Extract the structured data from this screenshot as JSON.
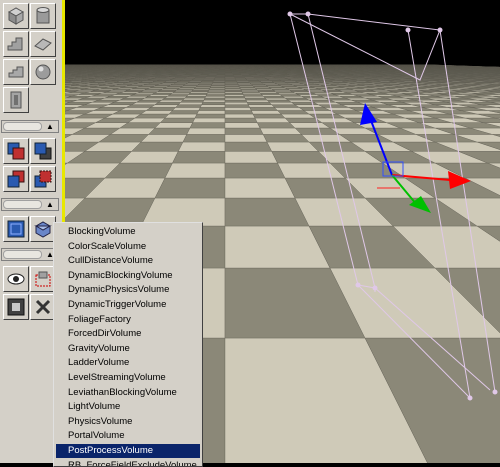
{
  "menu": {
    "items": [
      "BlockingVolume",
      "ColorScaleVolume",
      "CullDistanceVolume",
      "DynamicBlockingVolume",
      "DynamicPhysicsVolume",
      "DynamicTriggerVolume",
      "FoliageFactory",
      "ForcedDirVolume",
      "GravityVolume",
      "LadderVolume",
      "LevelStreamingVolume",
      "LeviathanBlockingVolume",
      "LightVolume",
      "PhysicsVolume",
      "PortalVolume",
      "PostProcessVolume",
      "RB_ForceFieldExcludeVolume"
    ],
    "selected": "PostProcessVolume"
  },
  "colors": {
    "toolbox_bg": "#d4d0c8",
    "viewport_divider": "#e8e800",
    "menu_highlight": "#0a246a",
    "floor_light": "#cfcab8",
    "floor_dark": "#8b8878",
    "volume_wireframe": "#e0c8e8",
    "gizmo_x": "#ff0000",
    "gizmo_y": "#00c000",
    "gizmo_z": "#0000ff"
  },
  "toolbox": {
    "icons": [
      "cube-brush-icon",
      "cylinder-brush-icon",
      "linear-stair-icon",
      "sheet-brush-icon",
      "spiral-stair-icon",
      "sphere-brush-icon",
      "door-volume-icon",
      "add-brush-icon",
      "subtract-brush-icon",
      "intersect-brush-icon",
      "deintersect-brush-icon",
      "add-volume-icon",
      "add-static-mesh-icon",
      "show-selected-icon",
      "hide-selected-icon",
      "select-icon",
      "close-icon"
    ]
  }
}
